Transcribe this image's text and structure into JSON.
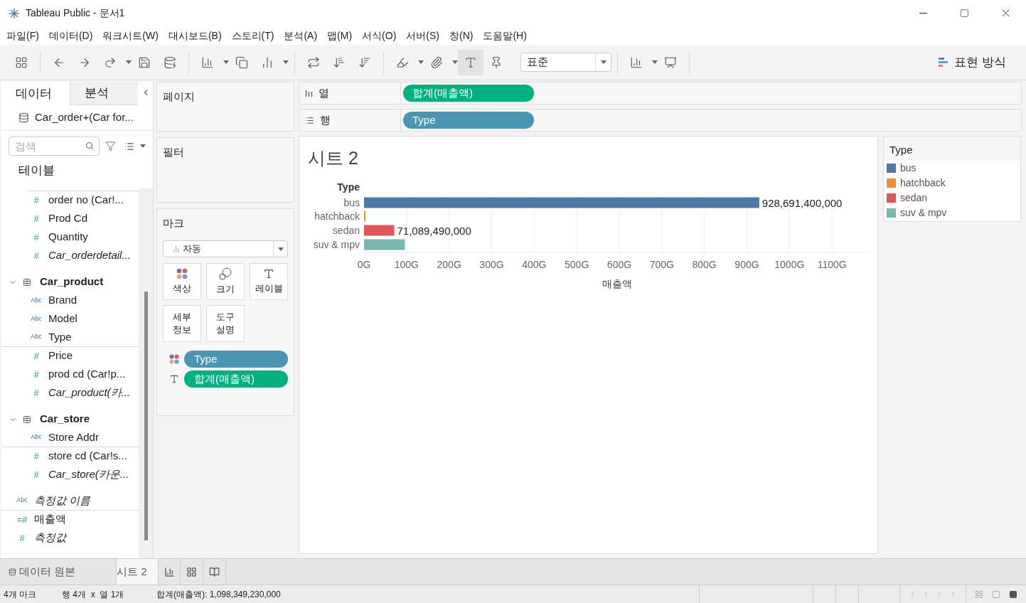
{
  "window": {
    "title": "Tableau Public - 문서1"
  },
  "menu": [
    "파일(F)",
    "데이터(D)",
    "워크시트(W)",
    "대시보드(B)",
    "스토리(T)",
    "분석(A)",
    "맵(M)",
    "서식(O)",
    "서버(S)",
    "창(N)",
    "도움말(H)"
  ],
  "toolbar": {
    "fit_dropdown": "표준",
    "show_me": "표현 방식"
  },
  "side_tabs": [
    {
      "label": "데이터",
      "selected": true
    },
    {
      "label": "분석",
      "selected": false
    }
  ],
  "data_source": "Car_order+(Car for...",
  "search": {
    "placeholder": "검색"
  },
  "tables_heading": "테이블",
  "field_groups": [
    {
      "fields": [
        {
          "name": "order no (Car!...",
          "kind": "measure",
          "type_icon": "#",
          "italic": false
        },
        {
          "name": "Prod Cd",
          "kind": "measure",
          "type_icon": "#",
          "italic": false
        },
        {
          "name": "Quantity",
          "kind": "measure",
          "type_icon": "#",
          "italic": false
        },
        {
          "name": "Car_orderdetail...",
          "kind": "measure",
          "type_icon": "#",
          "italic": true
        }
      ]
    },
    {
      "name": "Car_product",
      "expanded": true,
      "fields": [
        {
          "name": "Brand",
          "kind": "dimension",
          "type_icon": "Abc",
          "italic": false
        },
        {
          "name": "Model",
          "kind": "dimension",
          "type_icon": "Abc",
          "italic": false
        },
        {
          "name": "Type",
          "kind": "dimension",
          "type_icon": "Abc",
          "italic": false
        },
        {
          "name": "Price",
          "kind": "measure",
          "type_icon": "#",
          "italic": false
        },
        {
          "name": "prod cd (Car!p...",
          "kind": "measure",
          "type_icon": "#",
          "italic": false
        },
        {
          "name": "Car_product(카...",
          "kind": "measure",
          "type_icon": "#",
          "italic": true
        }
      ]
    },
    {
      "name": "Car_store",
      "expanded": true,
      "fields": [
        {
          "name": "Store Addr",
          "kind": "dimension",
          "type_icon": "Abc",
          "italic": false
        },
        {
          "name": "store cd (Car!s...",
          "kind": "measure",
          "type_icon": "#",
          "italic": false
        },
        {
          "name": "Car_store(카운...",
          "kind": "measure",
          "type_icon": "#",
          "italic": true
        }
      ]
    }
  ],
  "extra_fields": [
    {
      "name": "측정값 이름",
      "kind": "dimension",
      "type_icon": "Abc",
      "italic": true
    },
    {
      "name": "매출액",
      "kind": "measure",
      "type_icon": "=#",
      "italic": false
    },
    {
      "name": "측정값",
      "kind": "measure",
      "type_icon": "#",
      "italic": true
    }
  ],
  "pages_card": {
    "title": "페이지"
  },
  "filters_card": {
    "title": "필터"
  },
  "marks_card": {
    "title": "마크",
    "mark_type": "자동",
    "buttons": [
      "색상",
      "크기",
      "레이블",
      "세부 정보",
      "도구 설명"
    ],
    "fields": [
      {
        "name": "Type",
        "kind": "color",
        "measure": false
      },
      {
        "name": "합계(매출액)",
        "kind": "label",
        "measure": true
      }
    ]
  },
  "shelves": [
    {
      "label": "열",
      "kind": "columns",
      "pills": [
        {
          "name": "합계(매출액)",
          "measure": true
        }
      ]
    },
    {
      "label": "행",
      "kind": "rows",
      "pills": [
        {
          "name": "Type",
          "measure": false
        }
      ]
    }
  ],
  "sheet": {
    "title": "시트 2",
    "chart_data": {
      "type": "bar",
      "orientation": "horizontal",
      "xlabel": "매출액",
      "ylabel": "Type",
      "grid": true,
      "categories": [
        "bus",
        "hatchback",
        "sedan",
        "suv & mpv"
      ],
      "series": [
        {
          "values": [
            929,
            3,
            71,
            96
          ]
        }
      ],
      "colors": [
        "#4e79a7",
        "#f28e2b",
        "#e15759",
        "#76b7b2"
      ],
      "value_labels": [
        "928,691,400,000",
        null,
        "71,089,490,000",
        null
      ],
      "xlim": [
        0,
        1190
      ],
      "xticks": [
        {
          "value": 0,
          "label": "0G"
        },
        {
          "value": 100,
          "label": "100G"
        },
        {
          "value": 200,
          "label": "200G"
        },
        {
          "value": 300,
          "label": "300G"
        },
        {
          "value": 400,
          "label": "400G"
        },
        {
          "value": 500,
          "label": "500G"
        },
        {
          "value": 600,
          "label": "600G"
        },
        {
          "value": 700,
          "label": "700G"
        },
        {
          "value": 800,
          "label": "800G"
        },
        {
          "value": 900,
          "label": "900G"
        },
        {
          "value": 1000,
          "label": "1000G"
        },
        {
          "value": 1100,
          "label": "1100G"
        }
      ]
    }
  },
  "legend": {
    "title": "Type",
    "items": [
      {
        "label": "bus",
        "color": "#4e79a7"
      },
      {
        "label": "hatchback",
        "color": "#f28e2b"
      },
      {
        "label": "sedan",
        "color": "#e15759"
      },
      {
        "label": "suv & mpv",
        "color": "#76b7b2"
      }
    ]
  },
  "bottom_tabs": [
    {
      "label": "데이터 원본",
      "kind": "datasource",
      "selected": false
    },
    {
      "label": "시트 2",
      "kind": "sheet",
      "selected": true
    }
  ],
  "status_bar": {
    "marks": "4개 마크",
    "dims": "행 4개  x  열 1개",
    "sum": "합계(매출액): 1,098,349,230,000"
  }
}
